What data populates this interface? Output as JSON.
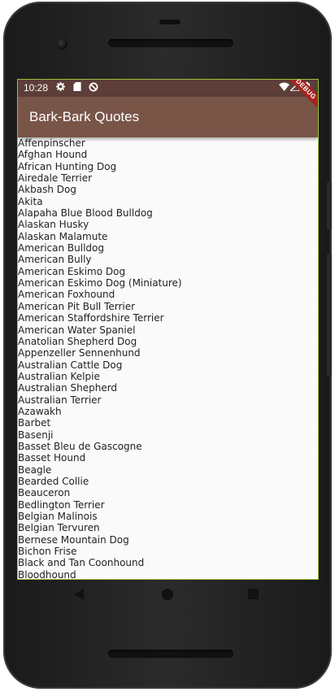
{
  "status_bar": {
    "time": "10:28",
    "icons": [
      "gear-icon",
      "sd-card-icon",
      "no-disturb-icon",
      "wifi-icon",
      "signal-icon",
      "battery-icon"
    ]
  },
  "app_bar": {
    "title": "Bark-Bark Quotes",
    "background": "#795548",
    "debug_label": "DEBUG"
  },
  "breeds": [
    "Affenpinscher",
    "Afghan Hound",
    "African Hunting Dog",
    "Airedale Terrier",
    "Akbash Dog",
    "Akita",
    "Alapaha Blue Blood Bulldog",
    "Alaskan Husky",
    "Alaskan Malamute",
    "American Bulldog",
    "American Bully",
    "American Eskimo Dog",
    "American Eskimo Dog (Miniature)",
    "American Foxhound",
    "American Pit Bull Terrier",
    "American Staffordshire Terrier",
    "American Water Spaniel",
    "Anatolian Shepherd Dog",
    "Appenzeller Sennenhund",
    "Australian Cattle Dog",
    "Australian Kelpie",
    "Australian Shepherd",
    "Australian Terrier",
    "Azawakh",
    "Barbet",
    "Basenji",
    "Basset Bleu de Gascogne",
    "Basset Hound",
    "Beagle",
    "Bearded Collie",
    "Beauceron",
    "Bedlington Terrier",
    "Belgian Malinois",
    "Belgian Tervuren",
    "Bernese Mountain Dog",
    "Bichon Frise",
    "Black and Tan Coonhound",
    "Bloodhound"
  ],
  "nav_bar": {
    "icons": [
      "back-icon",
      "home-icon",
      "recent-apps-icon"
    ]
  }
}
